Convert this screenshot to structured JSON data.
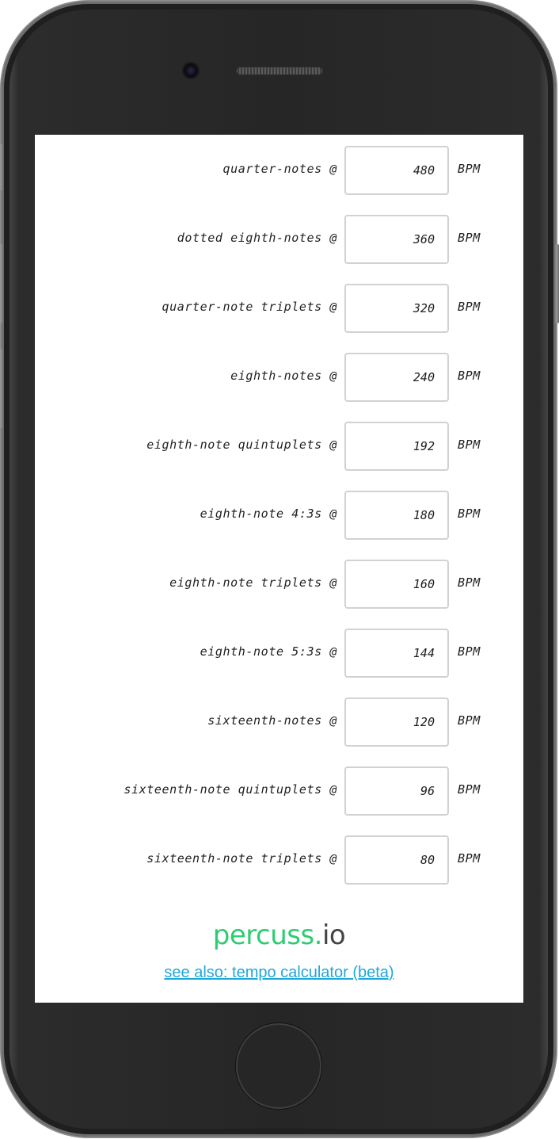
{
  "rows": [
    {
      "label": "quarter-notes @",
      "value": "480",
      "unit": "BPM"
    },
    {
      "label": "dotted eighth-notes @",
      "value": "360",
      "unit": "BPM"
    },
    {
      "label": "quarter-note triplets @",
      "value": "320",
      "unit": "BPM"
    },
    {
      "label": "eighth-notes @",
      "value": "240",
      "unit": "BPM"
    },
    {
      "label": "eighth-note quintuplets @",
      "value": "192",
      "unit": "BPM"
    },
    {
      "label": "eighth-note 4:3s @",
      "value": "180",
      "unit": "BPM"
    },
    {
      "label": "eighth-note triplets @",
      "value": "160",
      "unit": "BPM"
    },
    {
      "label": "eighth-note 5:3s @",
      "value": "144",
      "unit": "BPM"
    },
    {
      "label": "sixteenth-notes @",
      "value": "120",
      "unit": "BPM"
    },
    {
      "label": "sixteenth-note quintuplets @",
      "value": "96",
      "unit": "BPM"
    },
    {
      "label": "sixteenth-note triplets @",
      "value": "80",
      "unit": "BPM"
    }
  ],
  "footer": {
    "logo_main": "percuss",
    "logo_dot": ".",
    "logo_tld": "io",
    "link_text": "see also: tempo calculator (beta)"
  },
  "colors": {
    "brand_green": "#2ecc71",
    "link_blue": "#1fa8d8",
    "device_body": "#262626"
  }
}
